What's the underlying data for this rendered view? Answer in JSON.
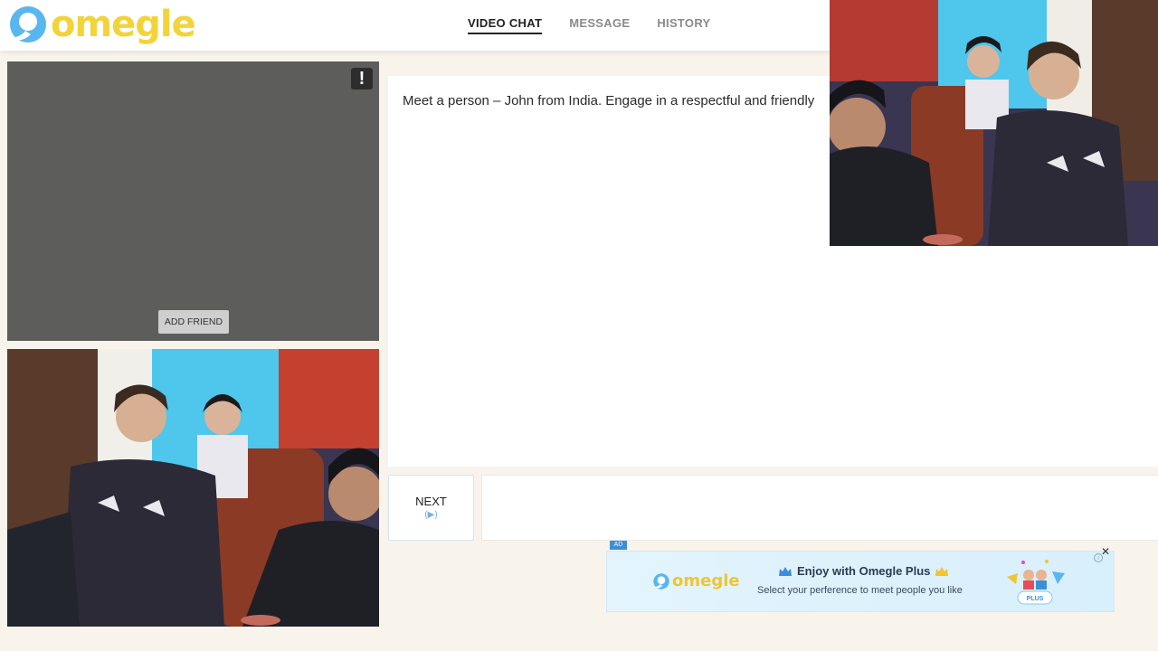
{
  "brand": {
    "name": "omegle",
    "logo_color": "#f2d43a",
    "logo_mark_color": "#58b6f0"
  },
  "nav": {
    "items": [
      {
        "label": "VIDEO CHAT",
        "active": true
      },
      {
        "label": "MESSAGE",
        "active": false
      },
      {
        "label": "HISTORY",
        "active": false
      }
    ]
  },
  "stranger_video": {
    "report_icon": "exclamation-icon",
    "report_label": "!",
    "add_friend_label": "ADD FRIEND"
  },
  "chat": {
    "system_message": "Meet a person – John from India. Engage in a respectful and friendly"
  },
  "controls": {
    "next_label": "NEXT",
    "next_key": "(▶)"
  },
  "ad": {
    "tag": "AD",
    "brand": "omegle",
    "title": "Enjoy with Omegle Plus",
    "subtitle": "Select your perference to meet people you like",
    "close_label": "✕",
    "info_label": "i",
    "plus_badge": "PLUS",
    "accent": "#3b8fd9"
  }
}
